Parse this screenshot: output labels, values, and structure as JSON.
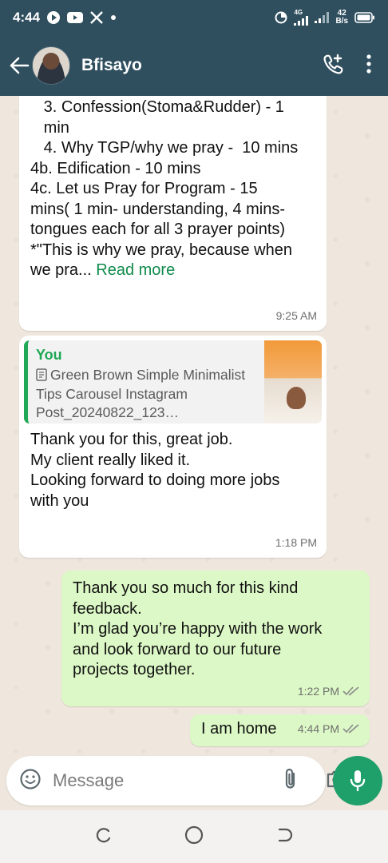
{
  "status_bar": {
    "time": "4:44",
    "signal_label": "4G",
    "net_speed_value": "42",
    "net_speed_unit": "B/s"
  },
  "header": {
    "contact_name": "Bfisayo"
  },
  "messages": {
    "m1": {
      "lines": [
        "   3. Confession(Stoma&Rudder) - 1",
        "   min",
        "",
        "   4. Why TGP/why we pray -  10 mins",
        "4b. Edification - 10 mins",
        "4c. Let us Pray for Program - 15",
        "mins( 1 min- understanding, 4 mins-",
        "tongues each for all 3 prayer points)",
        "",
        "*\"This is why we pray, because when"
      ],
      "last_line_prefix": "we pra... ",
      "read_more": "Read more",
      "time": "9:25 AM"
    },
    "m2": {
      "quote_author": "You",
      "quote_file": "Green Brown Simple Minimalist Tips Carousel Instagram Post_20240822_123…",
      "lines": [
        "Thank you for this, great job.",
        "",
        "My client really liked it.",
        "",
        "Looking forward to doing more jobs",
        "with you"
      ],
      "time": "1:18 PM"
    },
    "m3": {
      "lines": [
        "Thank you so much for this kind",
        "feedback.",
        "",
        "I’m glad you’re happy with the work",
        "and look forward to our future",
        "projects together."
      ],
      "time": "1:22 PM"
    },
    "m4": {
      "text": "I am home",
      "time": "4:44 PM"
    }
  },
  "composer": {
    "placeholder": "Message"
  },
  "colors": {
    "header_bg": "#2f4f5f",
    "chat_bg": "#efe7dd",
    "outgoing_bubble": "#dcf8c6",
    "accent_green": "#1fa06a"
  },
  "icons": {
    "back": "arrow-left-icon",
    "call": "add-call-icon",
    "menu": "more-vert-icon",
    "emoji": "emoji-icon",
    "attach": "paperclip-icon",
    "camera": "camera-icon",
    "mic": "mic-icon",
    "read": "double-check-icon"
  }
}
